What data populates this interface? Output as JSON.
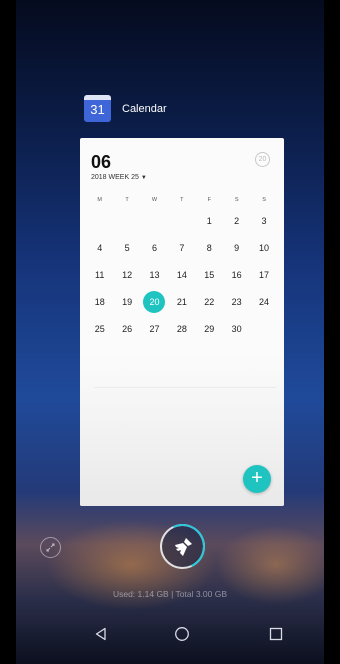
{
  "app": {
    "name": "Calendar",
    "icon_day": "31",
    "icon": "calendar-app-icon"
  },
  "calendar": {
    "month": "06",
    "week_label": "2018 WEEK 25",
    "today_badge": "20",
    "weekdays": [
      "M",
      "T",
      "W",
      "T",
      "F",
      "S",
      "S"
    ],
    "weeks": [
      [
        "",
        "",
        "",
        "",
        "1",
        "2",
        "3"
      ],
      [
        "4",
        "5",
        "6",
        "7",
        "8",
        "9",
        "10"
      ],
      [
        "11",
        "12",
        "13",
        "14",
        "15",
        "16",
        "17"
      ],
      [
        "18",
        "19",
        "20",
        "21",
        "22",
        "23",
        "24"
      ],
      [
        "25",
        "26",
        "27",
        "28",
        "29",
        "30",
        ""
      ]
    ],
    "selected_date": "20",
    "add_button": "+"
  },
  "memory": {
    "text": "Used: 1.14 GB | Total 3.00 GB"
  },
  "colors": {
    "accent": "#1fc4c0"
  },
  "icons": {
    "lock": "lock-apps-icon",
    "clean": "broom-clean-icon",
    "back": "back-triangle-icon",
    "home": "home-circle-icon",
    "recent": "recent-square-icon"
  }
}
